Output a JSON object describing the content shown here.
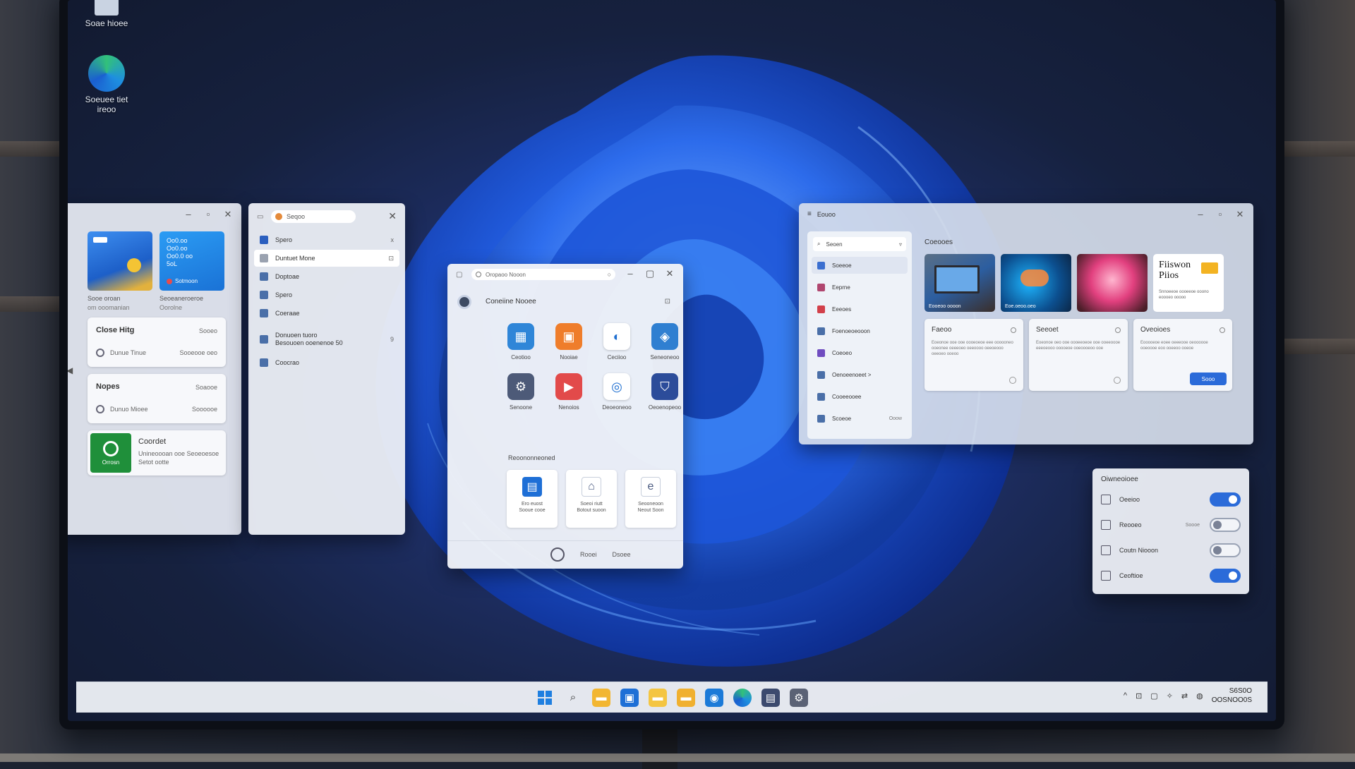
{
  "desktop": {
    "icons": [
      {
        "label": "Soae hioee",
        "icon": "recycle-bin-icon"
      },
      {
        "label": "Soeuee tiet ireoo",
        "icon": "edge-icon"
      }
    ]
  },
  "left_widgets": {
    "tile1": {
      "label": "Sooe oroan",
      "sub": "om ooomanian"
    },
    "tile2": {
      "text": "Oo0.oo\nOo0.oo\nOo0.0 oo\n5oL",
      "label": "Seoeaneroeroe",
      "sub": "Oorolne",
      "badge": "Sotmoon"
    },
    "card1": {
      "title": "Close Hitg",
      "right": "Sooeo",
      "row": "Dunue Tinue",
      "row_right": "Sooeooe oeo"
    },
    "card2": {
      "title": "Nopes",
      "right": "Soaooe",
      "row": "Dunuo Mioee",
      "row_right": "Soooooe"
    },
    "card3": {
      "title": "Coordet",
      "icon_label": "Orrosn",
      "line1": "Unineoooan ooe Seoeoesoe",
      "line2": "Setot ootte"
    }
  },
  "nav_window": {
    "search": "Seqoo",
    "items": [
      {
        "label": "Spero",
        "right": "x",
        "color": "#2b5fbf"
      },
      {
        "label": "Duntuet Mone",
        "right": "⊡",
        "color": "#9aa2b0",
        "selected": true
      },
      {
        "label": "Doptoae",
        "right": "",
        "color": "#4a6fa8"
      },
      {
        "label": "Spero",
        "right": "",
        "color": "#4a6fa8"
      },
      {
        "label": "Coeraae",
        "right": "",
        "color": "#4a6fa8"
      },
      {
        "label": "Donuoen tuoro\nBesouoen ooenenoe 50",
        "right": "9",
        "color": "#4a6fa8"
      },
      {
        "label": "Coocrao",
        "right": "",
        "color": "#4a6fa8"
      }
    ]
  },
  "start_window": {
    "search": "Oropaoo Nooon",
    "header": "Coneiine Nooee",
    "apps": [
      {
        "label": "Ceotioo",
        "icon": "calendar-icon",
        "color": "#2f86d8",
        "glyph": "▦"
      },
      {
        "label": "Nooiae",
        "icon": "briefcase-icon",
        "color": "#ef7d2b",
        "glyph": "▣"
      },
      {
        "label": "Ceciioo",
        "icon": "edge-icon",
        "color": "#ffffff",
        "glyph": "◐"
      },
      {
        "label": "Seneoneoo",
        "icon": "photos-icon",
        "color": "#2f7fd1",
        "glyph": "◈"
      },
      {
        "label": "Senoone",
        "icon": "settings-icon",
        "color": "#4d5a78",
        "glyph": "⚙"
      },
      {
        "label": "Nenoios",
        "icon": "media-icon",
        "color": "#e24a4a",
        "glyph": "▶"
      },
      {
        "label": "Deoeoneoo",
        "icon": "copilot-icon",
        "color": "#ffffff",
        "glyph": "◎"
      },
      {
        "label": "Oeoenopeoo",
        "icon": "shield-icon",
        "color": "#2c4c9a",
        "glyph": "⛉"
      }
    ],
    "rec_title": "Reoononneoned",
    "recs": [
      {
        "label": "Ero euost\nSooue cooe",
        "icon": "chart-doc-icon",
        "glyph": "▤"
      },
      {
        "label": "Soeoi riutt\nBotout suoon",
        "icon": "home-icon",
        "glyph": "⌂"
      },
      {
        "label": "Seooneoon\nNeout Soon",
        "icon": "edge-doc-icon",
        "glyph": "e"
      }
    ],
    "footer": [
      "Rooei",
      "Dsoee"
    ]
  },
  "gallery_window": {
    "title": "Eouoo",
    "search": "Seoen",
    "nav": [
      {
        "label": "Soeeoe",
        "color": "#3b6fd0",
        "selected": true
      },
      {
        "label": "Eeprne",
        "color": "#b0466f"
      },
      {
        "label": "Eeeoes",
        "color": "#d2404a"
      },
      {
        "label": "Foenoeoeooon",
        "color": "#4a6fa8"
      },
      {
        "label": "Coeoeo",
        "color": "#6f4cc0"
      },
      {
        "label": "Oenoeenoeet >",
        "color": "#4a6fa8"
      },
      {
        "label": "Cooeeooee",
        "color": "#4a6fa8"
      },
      {
        "label": "Scoeoe",
        "color": "#4a6fa8",
        "right": "Ooow"
      }
    ],
    "section": "Coeooes",
    "thumb_caption": "Eooeoo oooon",
    "thumb2_caption": "Eoe.oeoo.oeo",
    "promo_title": "Fiiswon\nPiios",
    "promo_text": "Snnoeeoe oooeeoe ooono eoooeo ooooo",
    "cards": [
      {
        "title": "Faeoo",
        "text": "Eoeonoe ooe ooe oooeoeoe eee oooooneo ooeonee oeeeoeo oeeoooo oeeoeooo oeeoeo ooeoo"
      },
      {
        "title": "Seeoet",
        "text": "Eoeonoe oeo ooe oooeeoeoe ooe ooeeoooe eeeoeooo ooooeoe ooeoooeoo ooe"
      },
      {
        "title": "Oveoioes",
        "text": "Eooooeoe eoee oeeeooe oeoooooe ooeoooe eoo ooeeoo ooeoe",
        "button": "Sooo"
      }
    ]
  },
  "settings_panel": {
    "title": "Oiwneoioee",
    "rows": [
      {
        "label": "Oeeioo",
        "right": "",
        "on": true,
        "icon": "display-icon"
      },
      {
        "label": "Reooeo",
        "right": "Soooe",
        "on": false,
        "icon": "printer-icon"
      },
      {
        "label": "Coutn Niooon",
        "right": "",
        "on": false,
        "icon": "camera-icon"
      },
      {
        "label": "Ceoftioe",
        "right": "",
        "on": true,
        "icon": "lock-icon"
      }
    ]
  },
  "taskbar": {
    "clock_time": "S6S0O",
    "clock_date": "OOSNOO0S",
    "tray": [
      "^",
      "⊡",
      "▢",
      "✧",
      "⇄",
      "◍"
    ]
  }
}
